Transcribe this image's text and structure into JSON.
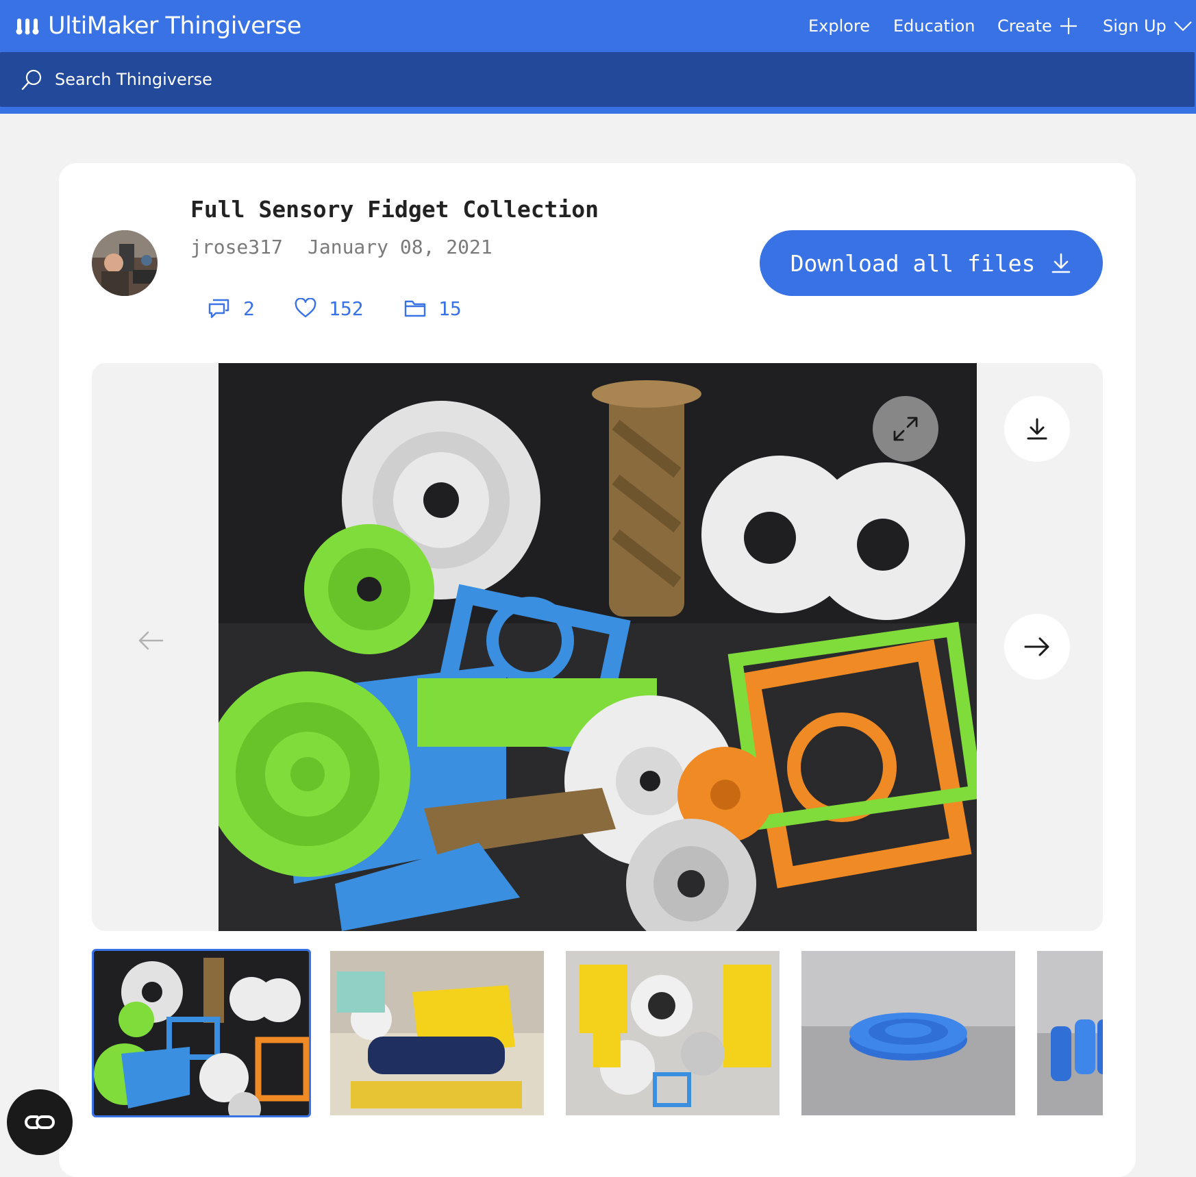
{
  "header": {
    "brand": "UltiMaker Thingiverse",
    "nav": {
      "explore": "Explore",
      "education": "Education",
      "create": "Create",
      "sign_up": "Sign Up"
    },
    "search": {
      "placeholder": "Search Thingiverse"
    }
  },
  "thing": {
    "title": "Full Sensory Fidget Collection",
    "author": "jrose317",
    "date": "January 08, 2021",
    "stats": {
      "comments": "2",
      "likes": "152",
      "collections": "15"
    },
    "download_label": "Download all files"
  },
  "gallery": {
    "thumbnails": [
      "photo-collection",
      "photo-box-yellow",
      "photo-box-mixed",
      "render-blue-spiral",
      "render-blue-partial"
    ]
  },
  "colors": {
    "brand_blue": "#3872e4",
    "search_bar": "#234a9a",
    "page_bg": "#f2f2f2"
  },
  "icons": [
    "thingiverse-logo-icon",
    "plus-icon",
    "chevron-down-icon",
    "search-icon",
    "comments-icon",
    "heart-icon",
    "folder-icon",
    "download-icon",
    "expand-icon",
    "arrow-left-icon",
    "arrow-right-icon",
    "cookie-settings-icon"
  ]
}
